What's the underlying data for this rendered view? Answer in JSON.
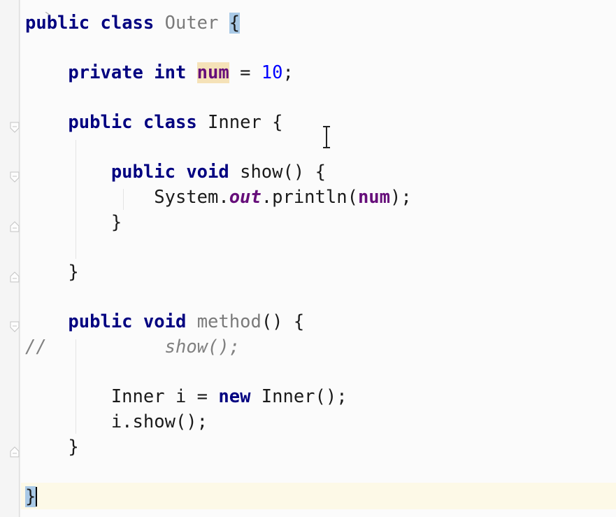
{
  "editor": {
    "lines": {
      "outer_class": {
        "kw_public": "public",
        "kw_class": "class",
        "name": "Outer",
        "brace": "{"
      },
      "field_decl": {
        "kw_private": "private",
        "kw_int": "int",
        "name": "num",
        "assign": " = ",
        "value": "10",
        "semicolon": ";"
      },
      "inner_class": {
        "kw_public": "public",
        "kw_class": "class",
        "name": "Inner",
        "brace": " {"
      },
      "show_method": {
        "kw_public": "public",
        "kw_void": "void",
        "name": "show",
        "rest": "() {"
      },
      "println_stmt": {
        "prefix": "System.",
        "field": "out",
        "call": ".println(",
        "arg": "num",
        "suffix": ");"
      },
      "show_close": {
        "brace": "}"
      },
      "inner_close": {
        "brace": "}"
      },
      "method_decl": {
        "kw_public": "public",
        "kw_void": "void",
        "name": "method",
        "rest": "() {"
      },
      "commented_call": {
        "marker": "//",
        "code": "show();"
      },
      "new_inner": {
        "type": "Inner i = ",
        "kw_new": "new",
        "rest": " Inner();"
      },
      "call_show": {
        "text": "i.show();"
      },
      "method_close": {
        "brace": "}"
      },
      "outer_close": {
        "brace": "}"
      }
    },
    "colors": {
      "keyword": "#000080",
      "field": "#660e7a",
      "number": "#0000ff",
      "comment": "#808080",
      "unused": "#7a7a7a",
      "brace_highlight": "#a9c9e6",
      "field_highlight": "#f5e2b8",
      "current_line": "#fdf9e7"
    },
    "icons": {
      "fold_open": "fold-open-icon",
      "fold_close": "fold-close-icon",
      "text_cursor": "ibeam-cursor-icon"
    }
  }
}
